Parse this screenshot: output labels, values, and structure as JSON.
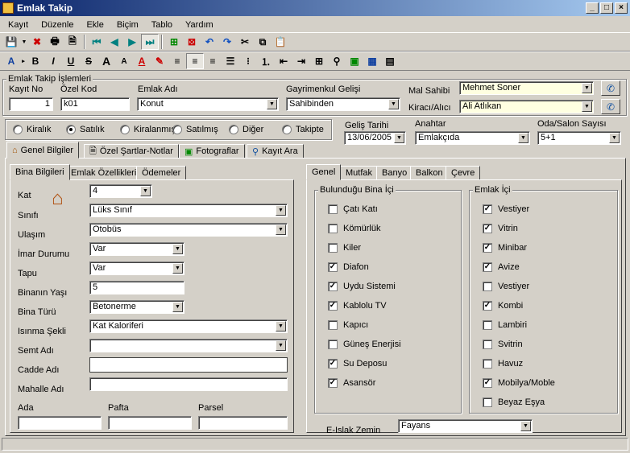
{
  "window": {
    "title": "Emlak Takip"
  },
  "menu": [
    "Kayıt",
    "Düzenle",
    "Ekle",
    "Biçim",
    "Tablo",
    "Yardım"
  ],
  "header": {
    "group_title": "Emlak Takip İşlemleri",
    "kayit_no_label": "Kayıt No",
    "kayit_no": "1",
    "ozel_kod_label": "Özel Kod",
    "ozel_kod": "k01",
    "emlak_adi_label": "Emlak Adı",
    "emlak_adi": "Konut",
    "gelis_label": "Gayrimenkul Gelişi",
    "gelis": "Sahibinden",
    "mal_sahibi_label": "Mal Sahibi",
    "mal_sahibi": "Mehmet Soner",
    "kiraci_label": "Kiracı/Alıcı",
    "kiraci": "Ali Atlıkan"
  },
  "status_options": [
    {
      "label": "Kiralık",
      "checked": false
    },
    {
      "label": "Satılık",
      "checked": true
    },
    {
      "label": "Kiralanmış",
      "checked": false
    },
    {
      "label": "Satılmış",
      "checked": false
    },
    {
      "label": "Diğer",
      "checked": false
    },
    {
      "label": "Takipte",
      "checked": false
    }
  ],
  "extra": {
    "gelis_tarihi_label": "Geliş Tarihi",
    "gelis_tarihi": "13/06/2005",
    "anahtar_label": "Anahtar",
    "anahtar": "Emlakçıda",
    "oda_label": "Oda/Salon Sayısı",
    "oda": "5+1"
  },
  "main_tabs": [
    "Genel Bilgiler",
    "Özel Şartlar-Notlar",
    "Fotograflar",
    "Kayıt Ara"
  ],
  "left_tabs": [
    "Bina Bilgileri",
    "Emlak Özellikleri",
    "Ödemeler"
  ],
  "fields": {
    "kat_label": "Kat",
    "kat": "4",
    "sinif_label": "Sınıfı",
    "sinif": "Lüks Sınıf",
    "ulasim_label": "Ulaşım",
    "ulasim": "Otobüs",
    "imar_label": "İmar Durumu",
    "imar": "Var",
    "tapu_label": "Tapu",
    "tapu": "Var",
    "yas_label": "Binanın Yaşı",
    "yas": "5",
    "tur_label": "Bina Türü",
    "tur": "Betonerme",
    "isinma_label": "Isınma Şekli",
    "isinma": "Kat Kaloriferi",
    "semt_label": "Semt Adı",
    "semt": "",
    "cadde_label": "Cadde Adı",
    "cadde": "",
    "mahalle_label": "Mahalle Adı",
    "mahalle": "",
    "ada_label": "Ada",
    "ada": "",
    "pafta_label": "Pafta",
    "pafta": "",
    "parsel_label": "Parsel",
    "parsel": ""
  },
  "right_tabs": [
    "Genel",
    "Mutfak",
    "Banyo",
    "Balkon",
    "Çevre"
  ],
  "bina_ici": {
    "title": "Bulunduğu Bina İçi",
    "items": [
      {
        "label": "Çatı Katı",
        "checked": false
      },
      {
        "label": "Kömürlük",
        "checked": false
      },
      {
        "label": "Kiler",
        "checked": false
      },
      {
        "label": "Diafon",
        "checked": true
      },
      {
        "label": "Uydu Sistemi",
        "checked": true
      },
      {
        "label": "Kablolu TV",
        "checked": true
      },
      {
        "label": "Kapıcı",
        "checked": false
      },
      {
        "label": "Güneş Enerjisi",
        "checked": false
      },
      {
        "label": "Su Deposu",
        "checked": true
      },
      {
        "label": "Asansör",
        "checked": true
      }
    ]
  },
  "emlak_ici": {
    "title": "Emlak İçi",
    "items": [
      {
        "label": "Vestiyer",
        "checked": true
      },
      {
        "label": "Vitrin",
        "checked": true
      },
      {
        "label": "Minibar",
        "checked": true
      },
      {
        "label": "Avize",
        "checked": true
      },
      {
        "label": "Vestiyer",
        "checked": false
      },
      {
        "label": "Kombi",
        "checked": true
      },
      {
        "label": "Lambiri",
        "checked": false
      },
      {
        "label": "Svitrin",
        "checked": false
      },
      {
        "label": "Havuz",
        "checked": false
      },
      {
        "label": "Mobilya/Moble",
        "checked": true
      },
      {
        "label": "Beyaz Eşya",
        "checked": false
      }
    ]
  },
  "zemin": {
    "label": "E-Islak Zemin",
    "value": "Fayans"
  }
}
